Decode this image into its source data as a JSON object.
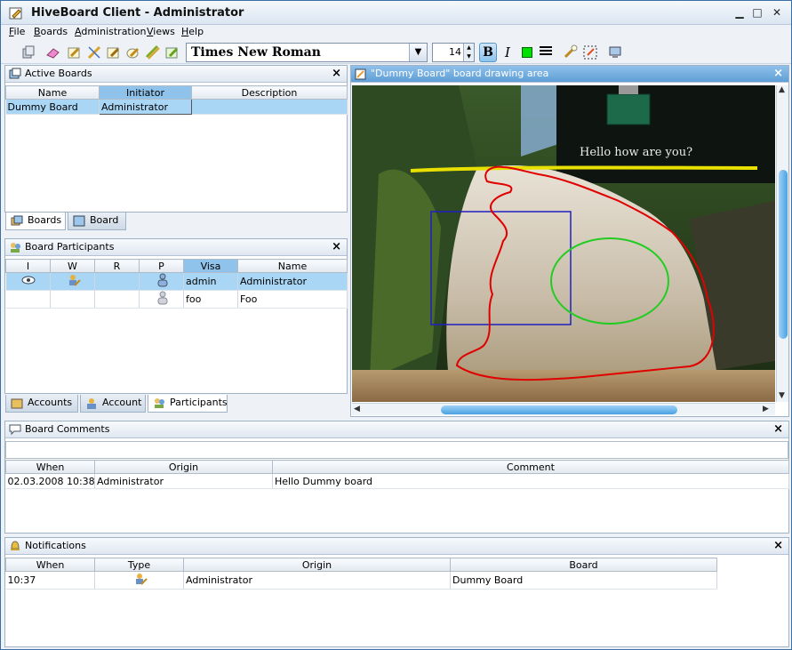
{
  "window": {
    "title": "HiveBoard Client - Administrator",
    "minimize": "▁",
    "maximize": "□",
    "close": "✕"
  },
  "menu": [
    {
      "label": "File",
      "key": "F",
      "rest": "ile"
    },
    {
      "label": "Boards",
      "key": "B",
      "rest": "oards"
    },
    {
      "label": "Administration",
      "key": "A",
      "rest": "dministration"
    },
    {
      "label": "Views",
      "key": "V",
      "rest": "iews"
    },
    {
      "label": "Help",
      "key": "H",
      "rest": "elp"
    }
  ],
  "toolbar": {
    "font": "Times New Roman",
    "font_arrow": "▼",
    "size": "14",
    "bold": "B",
    "italic": "I",
    "color": "#00e000",
    "icons": [
      "eraser-icon",
      "pencil-icon",
      "line-icon",
      "rectangle-icon",
      "ellipse-icon",
      "highlight-icon",
      "text-icon",
      "select-icon",
      "selection-frame-icon",
      "monitor-icon"
    ]
  },
  "active_boards": {
    "title": "Active Boards",
    "columns": [
      "Name",
      "Initiator",
      "Description"
    ],
    "rows": [
      [
        "Dummy Board",
        "Administrator",
        ""
      ]
    ],
    "tabs": [
      "Boards",
      "Board"
    ]
  },
  "participants": {
    "title": "Board Participants",
    "columns": [
      "I",
      "W",
      "R",
      "P",
      "Visa",
      "Name"
    ],
    "rows": [
      {
        "visa": "admin",
        "name": "Administrator"
      },
      {
        "visa": "foo",
        "name": "Foo"
      }
    ],
    "tabs": [
      "Accounts",
      "Account",
      "Participants"
    ]
  },
  "drawing": {
    "title": "\"Dummy Board\" board drawing area",
    "text": "Hello how are you?"
  },
  "comments": {
    "title": "Board Comments",
    "columns": [
      "When",
      "Origin",
      "Comment"
    ],
    "rows": [
      [
        "02.03.2008 10:38",
        "Administrator",
        "Hello Dummy board"
      ]
    ]
  },
  "notifications": {
    "title": "Notifications",
    "columns": [
      "When",
      "Type",
      "Origin",
      "Board"
    ],
    "rows": [
      [
        "10:37",
        "",
        "Administrator",
        "Dummy Board"
      ]
    ]
  },
  "colors": {
    "accent": "#5f9fd6",
    "selection": "#a9d6f5",
    "pen_red": "#e00000",
    "pen_green": "#22cc22",
    "pen_yellow": "#e8e000",
    "pen_blue": "#2020c0"
  }
}
